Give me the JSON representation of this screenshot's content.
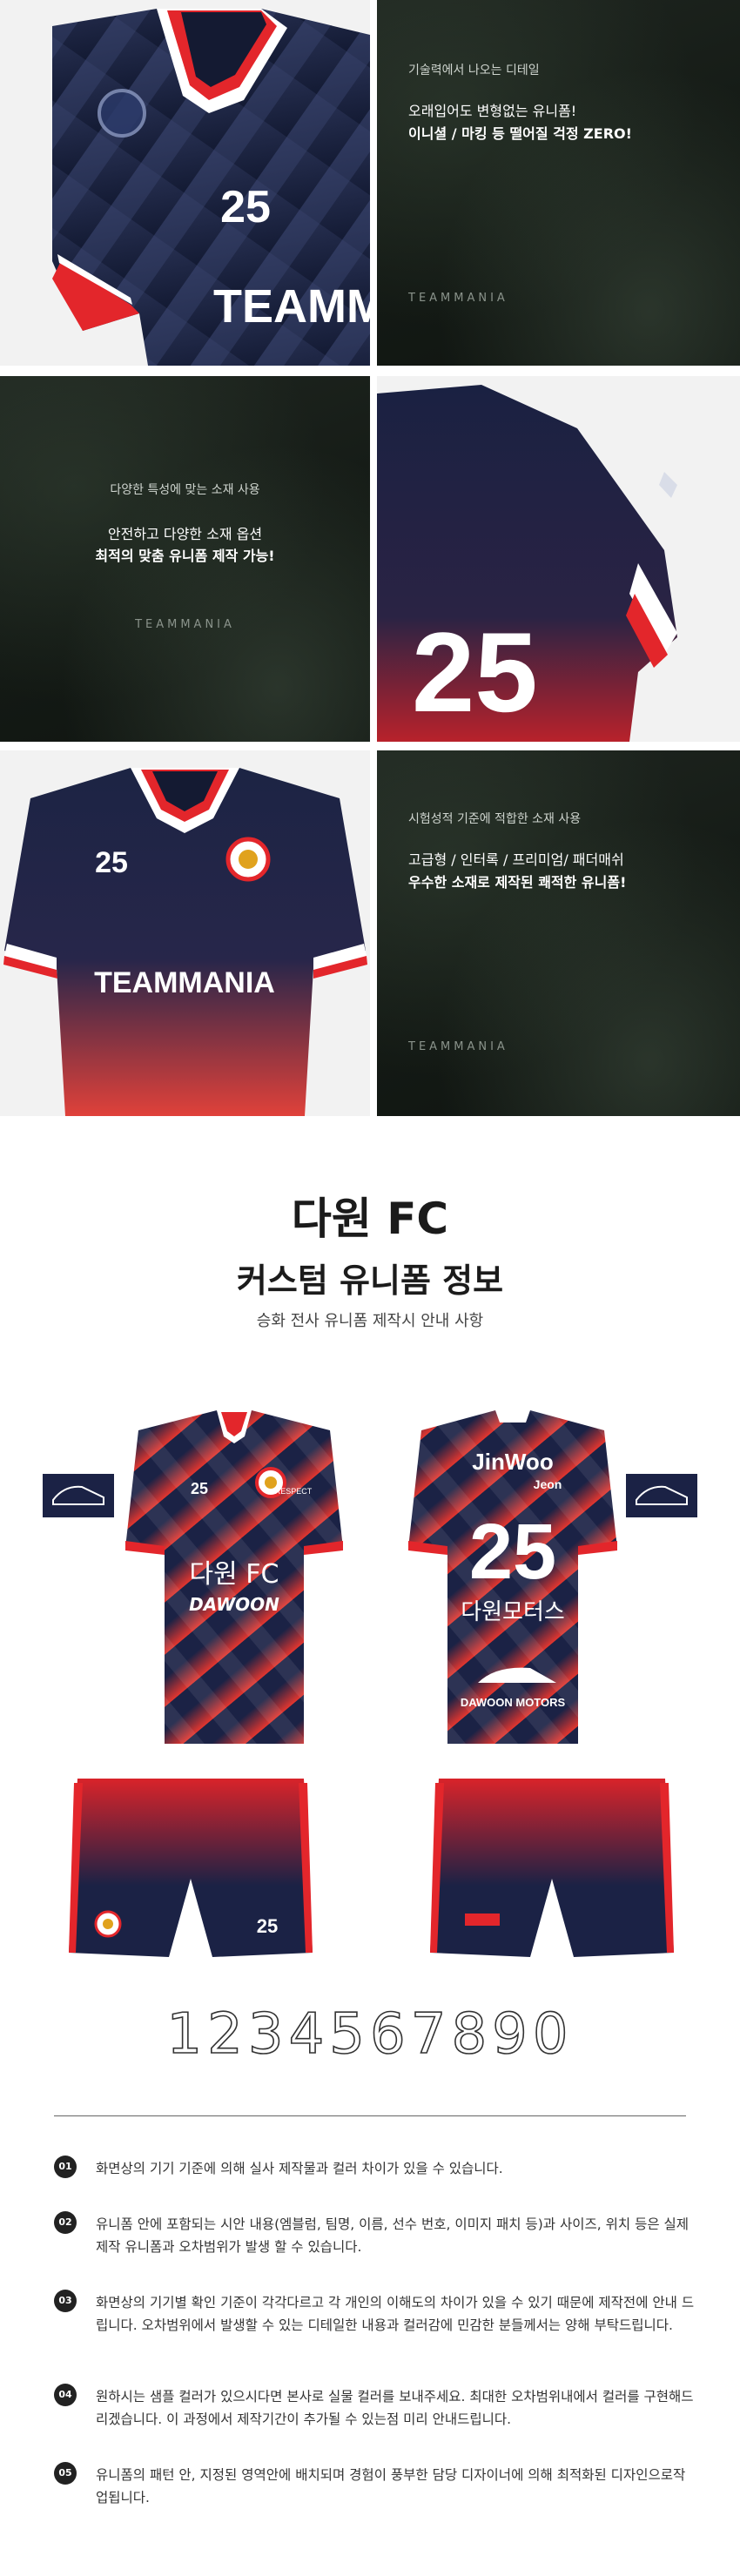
{
  "panel_2": {
    "line1": "기술력에서 나오는 디테일",
    "line2": "오래입어도 변형없는 유니폼!",
    "line3": "이니셜 / 마킹 등 떨어질 걱정 ZERO!"
  },
  "panel_1": {
    "number": "25",
    "team": "TEAMMA",
    "overflow_brand": "TEAMMANIA"
  },
  "panel_3": {
    "line1": "다양한 특성에 맞는 소재 사용",
    "line2": "안전하고 다양한 소재 옵션",
    "line3": "최적의 맞춤 유니폼 제작 가능!",
    "brand": "TEAMMANIA"
  },
  "panel_4": {
    "number": "25"
  },
  "panel_5": {
    "number": "25",
    "team": "TEAMMANIA"
  },
  "panel_6": {
    "line1": "시험성적 기준에 적합한 소재 사용",
    "line2": "고급형 / 인터록 / 프리미엄/ 패더매쉬",
    "line3": "우수한 소재로 제작된 쾌적한 유니폼!",
    "brand": "TEAMMANIA"
  },
  "detail": {
    "team_name": "다원 FC",
    "title": "커스텀 유니폼 정보",
    "subtitle": "승화 전사 유니폼 제작시 안내 사항"
  },
  "mockup": {
    "front_number": "25",
    "front_chest": "다원 FC",
    "front_script": "DAWOON",
    "back_name": "JinWoo",
    "back_sub": "Jeon",
    "back_number": "25",
    "back_sponsor": "다원모터스",
    "back_logo": "DAWOON MOTORS",
    "shorts_number": "25",
    "sleeve_patch": "RESPECT",
    "digits": "1234567890"
  },
  "notes": [
    {
      "no": "01",
      "text": "화면상의 기기 기준에 의해 실사 제작물과 컬러 차이가 있을 수 있습니다."
    },
    {
      "no": "02",
      "text": "유니폼 안에 포함되는 시안 내용(엠블럼, 팀명, 이름, 선수 번호, 이미지 패치 등)과 사이즈, 위치 등은 실제 제작 유니폼과 오차범위가 발생 할 수 있습니다."
    },
    {
      "no": "03",
      "text": "화면상의 기기별 확인 기준이 각각다르고 각 개인의 이해도의 차이가 있을 수 있기 때문에 제작전에 안내 드립니다. 오차범위에서 발생할 수 있는 디테일한 내용과 컬러감에 민감한 분들께서는 양해 부탁드립니다."
    },
    {
      "no": "04",
      "text": "원하시는 샘플 컬러가 있으시다면 본사로 실물 컬러를 보내주세요. 최대한 오차범위내에서 컬러를 구현해드리겠습니다. 이 과정에서 제작기간이 추가될 수 있는점 미리 안내드립니다."
    },
    {
      "no": "05",
      "text": "유니폼의 패턴 안, 지정된 영역안에 배치되며 경험이 풍부한 담당 디자이너에 의해 최적화된 디자인으로작업됩니다."
    }
  ],
  "colors": {
    "navy": "#1c2340",
    "red": "#e0282c",
    "dark_bg": "#171d18"
  }
}
